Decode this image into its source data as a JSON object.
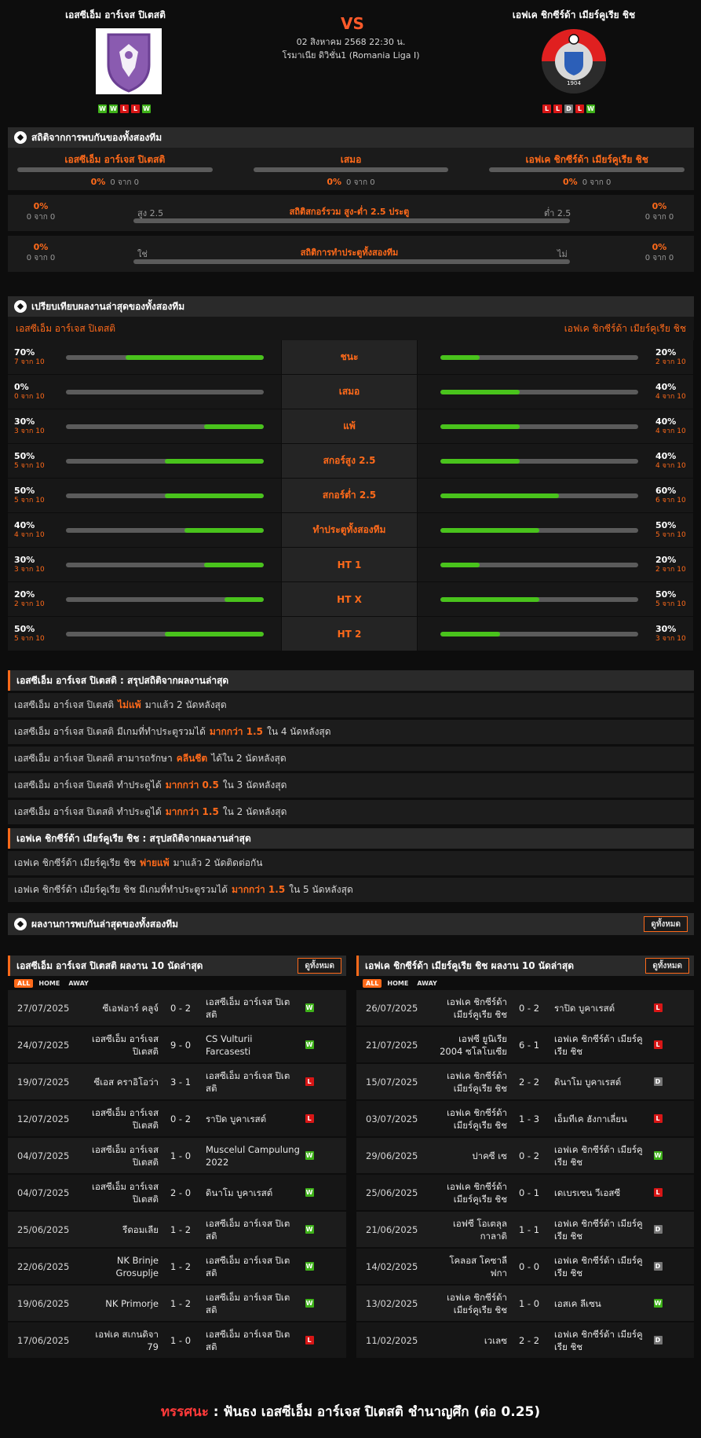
{
  "header": {
    "home_name": "เอสซีเอ็ม อาร์เจส ปิเตสติ",
    "away_name": "เอฟเค ชิกซีร์ด้า เมียร์คูเรีย ชิช",
    "vs": "VS",
    "datetime": "02 สิงหาคม 2568 22:30 น.",
    "league": "โรมาเนีย ดิวิชั่น1 (Romania Liga I)",
    "home_form": [
      "W",
      "W",
      "L",
      "L",
      "W"
    ],
    "away_form": [
      "L",
      "L",
      "D",
      "L",
      "W"
    ],
    "away_logo_text": "1904"
  },
  "h2h": {
    "title": "สถิติจากการพบกันของทั้งสองทีม",
    "cols": [
      {
        "label": "เอสซีเอ็ม อาร์เจส ปิเตสติ",
        "pct": "0%",
        "count": "0 จาก 0"
      },
      {
        "label": "เสมอ",
        "pct": "0%",
        "count": "0 จาก 0"
      },
      {
        "label": "เอฟเค ชิกซีร์ด้า เมียร์คูเรีย ชิช",
        "pct": "0%",
        "count": "0 จาก 0"
      }
    ],
    "ou": {
      "title": "สถิติสกอร์รวม สูง-ต่ำ 2.5 ประตู",
      "left_label": "สูง 2.5",
      "right_label": "ต่ำ 2.5",
      "left_pct": "0%",
      "left_count": "0 จาก 0",
      "right_pct": "0%",
      "right_count": "0 จาก 0"
    },
    "btts": {
      "title": "สถิติการทำประตูทั้งสองทีม",
      "left_label": "ใช่",
      "right_label": "ไม่",
      "left_pct": "0%",
      "left_count": "0 จาก 0",
      "right_pct": "0%",
      "right_count": "0 จาก 0"
    }
  },
  "compare": {
    "title": "เปรียบเทียบผลงานล่าสุดของทั้งสองทีม",
    "home_label": "เอสซีเอ็ม อาร์เจส ปิเตสติ",
    "away_label": "เอฟเค ชิกซีร์ด้า เมียร์คูเรีย ชิช",
    "rows": [
      {
        "label": "ชนะ",
        "home_pct": "70%",
        "home_count": "7 จาก 10",
        "home_val": 0.7,
        "away_pct": "20%",
        "away_count": "2 จาก 10",
        "away_val": 0.2
      },
      {
        "label": "เสมอ",
        "home_pct": "0%",
        "home_count": "0 จาก 10",
        "home_val": 0.0,
        "away_pct": "40%",
        "away_count": "4 จาก 10",
        "away_val": 0.4
      },
      {
        "label": "แพ้",
        "home_pct": "30%",
        "home_count": "3 จาก 10",
        "home_val": 0.3,
        "away_pct": "40%",
        "away_count": "4 จาก 10",
        "away_val": 0.4
      },
      {
        "label": "สกอร์สูง 2.5",
        "home_pct": "50%",
        "home_count": "5 จาก 10",
        "home_val": 0.5,
        "away_pct": "40%",
        "away_count": "4 จาก 10",
        "away_val": 0.4
      },
      {
        "label": "สกอร์ต่ำ 2.5",
        "home_pct": "50%",
        "home_count": "5 จาก 10",
        "home_val": 0.5,
        "away_pct": "60%",
        "away_count": "6 จาก 10",
        "away_val": 0.6
      },
      {
        "label": "ทำประตูทั้งสองทีม",
        "home_pct": "40%",
        "home_count": "4 จาก 10",
        "home_val": 0.4,
        "away_pct": "50%",
        "away_count": "5 จาก 10",
        "away_val": 0.5
      },
      {
        "label": "HT 1",
        "home_pct": "30%",
        "home_count": "3 จาก 10",
        "home_val": 0.3,
        "away_pct": "20%",
        "away_count": "2 จาก 10",
        "away_val": 0.2
      },
      {
        "label": "HT X",
        "home_pct": "20%",
        "home_count": "2 จาก 10",
        "home_val": 0.2,
        "away_pct": "50%",
        "away_count": "5 จาก 10",
        "away_val": 0.5
      },
      {
        "label": "HT 2",
        "home_pct": "50%",
        "home_count": "5 จาก 10",
        "home_val": 0.5,
        "away_pct": "30%",
        "away_count": "3 จาก 10",
        "away_val": 0.3
      }
    ]
  },
  "home_summary": {
    "title": "เอสซีเอ็ม อาร์เจส ปิเตสติ : สรุปสถิติจากผลงานล่าสุด",
    "rows": [
      {
        "pre": "เอสซีเอ็ม อาร์เจส ปิเตสติ",
        "hl": "ไม่แพ้",
        "post": "มาแล้ว 2 นัดหลังสุด"
      },
      {
        "pre": "เอสซีเอ็ม อาร์เจส ปิเตสติ มีเกมที่ทำประตูรวมได้",
        "hl": "มากกว่า 1.5",
        "post": "ใน 4 นัดหลังสุด"
      },
      {
        "pre": "เอสซีเอ็ม อาร์เจส ปิเตสติ สามารถรักษา",
        "hl": "คลีนชีต",
        "post": "ได้ใน 2 นัดหลังสุด"
      },
      {
        "pre": "เอสซีเอ็ม อาร์เจส ปิเตสติ ทำประตูได้",
        "hl": "มากกว่า 0.5",
        "post": "ใน 3 นัดหลังสุด"
      },
      {
        "pre": "เอสซีเอ็ม อาร์เจส ปิเตสติ ทำประตูได้",
        "hl": "มากกว่า 1.5",
        "post": "ใน 2 นัดหลังสุด"
      }
    ]
  },
  "away_summary": {
    "title": "เอฟเค ชิกซีร์ด้า เมียร์คูเรีย ชิช : สรุปสถิติจากผลงานล่าสุด",
    "rows": [
      {
        "pre": "เอฟเค ชิกซีร์ด้า เมียร์คูเรีย ชิช",
        "hl": "พ่ายแพ้",
        "post": "มาแล้ว 2 นัดติดต่อกัน"
      },
      {
        "pre": "เอฟเค ชิกซีร์ด้า เมียร์คูเรีย ชิช มีเกมที่ทำประตูรวมได้",
        "hl": "มากกว่า 1.5",
        "post": "ใน 5 นัดหลังสุด"
      }
    ]
  },
  "recent_h2h": {
    "title": "ผลงานการพบกันล่าสุดของทั้งสองทีม",
    "view_all": "ดูทั้งหมด"
  },
  "home_last10": {
    "title": "เอสซีเอ็ม อาร์เจส ปิเตสติ ผลงาน 10 นัดล่าสุด",
    "view_all": "ดูทั้งหมด",
    "filters": [
      "ALL",
      "HOME",
      "AWAY"
    ],
    "matches": [
      {
        "date": "27/07/2025",
        "home": "ซีเอฟอาร์ คลูจ์",
        "score": "0 - 2",
        "away": "เอสซีเอ็ม อาร์เจส ปิเตสติ",
        "res": "W"
      },
      {
        "date": "24/07/2025",
        "home": "เอสซีเอ็ม อาร์เจส ปิเตสติ",
        "score": "9 - 0",
        "away": "CS Vulturii Farcasesti",
        "res": "W"
      },
      {
        "date": "19/07/2025",
        "home": "ซีเอส คราอิโอว่า",
        "score": "3 - 1",
        "away": "เอสซีเอ็ม อาร์เจส ปิเตสติ",
        "res": "L"
      },
      {
        "date": "12/07/2025",
        "home": "เอสซีเอ็ม อาร์เจส ปิเตสติ",
        "score": "0 - 2",
        "away": "ราปิด บูคาเรสต์",
        "res": "L"
      },
      {
        "date": "04/07/2025",
        "home": "เอสซีเอ็ม อาร์เจส ปิเตสติ",
        "score": "1 - 0",
        "away": "Muscelul Campulung 2022",
        "res": "W"
      },
      {
        "date": "04/07/2025",
        "home": "เอสซีเอ็ม อาร์เจส ปิเตสติ",
        "score": "2 - 0",
        "away": "ดินาโม บูคาเรสต์",
        "res": "W"
      },
      {
        "date": "25/06/2025",
        "home": "รีดอมเลีย",
        "score": "1 - 2",
        "away": "เอสซีเอ็ม อาร์เจส ปิเตสติ",
        "res": "W"
      },
      {
        "date": "22/06/2025",
        "home": "NK Brinje Grosuplje",
        "score": "1 - 2",
        "away": "เอสซีเอ็ม อาร์เจส ปิเตสติ",
        "res": "W"
      },
      {
        "date": "19/06/2025",
        "home": "NK Primorje",
        "score": "1 - 2",
        "away": "เอสซีเอ็ม อาร์เจส ปิเตสติ",
        "res": "W"
      },
      {
        "date": "17/06/2025",
        "home": "เอฟเค สเกนดิจา 79",
        "score": "1 - 0",
        "away": "เอสซีเอ็ม อาร์เจส ปิเตสติ",
        "res": "L"
      }
    ]
  },
  "away_last10": {
    "title": "เอฟเค ชิกซีร์ด้า เมียร์คูเรีย ชิช ผลงาน 10 นัดล่าสุด",
    "view_all": "ดูทั้งหมด",
    "filters": [
      "ALL",
      "HOME",
      "AWAY"
    ],
    "matches": [
      {
        "date": "26/07/2025",
        "home": "เอฟเค ชิกซีร์ด้า เมียร์คูเรีย ชิช",
        "score": "0 - 2",
        "away": "ราปิด บูคาเรสต์",
        "res": "L"
      },
      {
        "date": "21/07/2025",
        "home": "เอฟซี ยูนิเรีย 2004 ซโลโบเซีย",
        "score": "6 - 1",
        "away": "เอฟเค ชิกซีร์ด้า เมียร์คูเรีย ชิช",
        "res": "L"
      },
      {
        "date": "15/07/2025",
        "home": "เอฟเค ชิกซีร์ด้า เมียร์คูเรีย ชิช",
        "score": "2 - 2",
        "away": "ดินาโม บูคาเรสต์",
        "res": "D"
      },
      {
        "date": "03/07/2025",
        "home": "เอฟเค ชิกซีร์ด้า เมียร์คูเรีย ชิช",
        "score": "1 - 3",
        "away": "เอ็มทีเค ฮังกาเลี่ยน",
        "res": "L"
      },
      {
        "date": "29/06/2025",
        "home": "ปาคซี เซ",
        "score": "0 - 2",
        "away": "เอฟเค ชิกซีร์ด้า เมียร์คูเรีย ชิช",
        "res": "W"
      },
      {
        "date": "25/06/2025",
        "home": "เอฟเค ชิกซีร์ด้า เมียร์คูเรีย ชิช",
        "score": "0 - 1",
        "away": "เดเบรเซน วีเอสซี",
        "res": "L"
      },
      {
        "date": "21/06/2025",
        "home": "เอฟซี โอเตลุล กาลาติ",
        "score": "1 - 1",
        "away": "เอฟเค ชิกซีร์ด้า เมียร์คูเรีย ชิช",
        "res": "D"
      },
      {
        "date": "14/02/2025",
        "home": "โคลอส โคซาลีฟกา",
        "score": "0 - 0",
        "away": "เอฟเค ชิกซีร์ด้า เมียร์คูเรีย ชิช",
        "res": "D"
      },
      {
        "date": "13/02/2025",
        "home": "เอฟเค ชิกซีร์ด้า เมียร์คูเรีย ชิช",
        "score": "1 - 0",
        "away": "เอสเค ลีเซน",
        "res": "W"
      },
      {
        "date": "11/02/2025",
        "home": "เวเลซ",
        "score": "2 - 2",
        "away": "เอฟเค ชิกซีร์ด้า เมียร์คูเรีย ชิช",
        "res": "D"
      }
    ]
  },
  "footer": {
    "label": "ทรรศนะ",
    "sep": ":",
    "tip": "ฟันธง เอสซีเอ็ม อาร์เจส ปิเตสติ ชำนาญศึก (ต่อ 0.25)"
  },
  "colors": {
    "accent": "#ff6a1a",
    "win": "#3fb21a",
    "loss": "#d81616",
    "draw": "#777777",
    "bar_fill": "#49c31c"
  }
}
